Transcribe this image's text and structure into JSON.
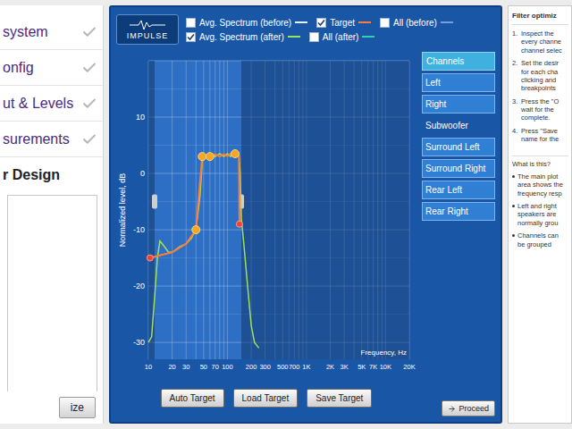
{
  "sidebar": {
    "items": [
      {
        "label": "system",
        "checked": true,
        "selected": false
      },
      {
        "label": "onfig",
        "checked": true,
        "selected": false
      },
      {
        "label": "ut & Levels",
        "checked": true,
        "selected": false
      },
      {
        "label": "surements",
        "checked": true,
        "selected": false
      },
      {
        "label": "r Design",
        "checked": false,
        "selected": true
      }
    ],
    "bottom_button": "ize"
  },
  "logo": "IMPULSE",
  "legend": [
    [
      {
        "label": "Avg. Spectrum (before)",
        "checked": false,
        "color": "#e8eef6"
      },
      {
        "label": "Target",
        "checked": true,
        "color": "#ff7b3a"
      },
      {
        "label": "All (before)",
        "checked": false,
        "color": "#6fa0e0"
      }
    ],
    [
      {
        "label": "Avg. Spectrum (after)",
        "checked": true,
        "color": "#9fe05a"
      },
      {
        "label": "All (after)",
        "checked": false,
        "color": "#2fd3a8"
      }
    ]
  ],
  "chart": {
    "y_axis_title": "Normalized level, dB",
    "x_axis_title": "Frequency, Hz",
    "y_range_db": [
      -33,
      20
    ],
    "x_range_hz": [
      10,
      20000
    ],
    "passband_hz": [
      12,
      150
    ],
    "y_ticks": [
      "10",
      "0",
      "-10",
      "-20",
      "-30"
    ],
    "x_ticks": [
      {
        "label": "10",
        "hz": 10
      },
      {
        "label": "20",
        "hz": 20
      },
      {
        "label": "30",
        "hz": 30
      },
      {
        "label": "50",
        "hz": 50
      },
      {
        "label": "70",
        "hz": 70
      },
      {
        "label": "100",
        "hz": 100
      },
      {
        "label": "200",
        "hz": 200
      },
      {
        "label": "300",
        "hz": 300
      },
      {
        "label": "500",
        "hz": 500
      },
      {
        "label": "700",
        "hz": 700
      },
      {
        "label": "1K",
        "hz": 1000
      },
      {
        "label": "2K",
        "hz": 2000
      },
      {
        "label": "3K",
        "hz": 3000
      },
      {
        "label": "5K",
        "hz": 5000
      },
      {
        "label": "7K",
        "hz": 7000
      },
      {
        "label": "10K",
        "hz": 10000
      },
      {
        "label": "20K",
        "hz": 20000
      }
    ],
    "series": [
      {
        "name": "Avg. Spectrum (after)",
        "color": "#9fe05a",
        "frequencies": [
          10,
          11,
          12,
          13,
          14,
          16,
          18,
          20,
          25,
          30,
          35,
          40,
          45,
          48,
          50,
          60,
          70,
          80,
          90,
          100,
          110,
          120,
          130,
          140,
          145,
          150,
          160,
          180,
          200,
          220,
          250
        ],
        "values": [
          -30,
          -29,
          -22,
          -15,
          -12,
          -13,
          -14,
          -14,
          -13,
          -12.5,
          -11.5,
          -10,
          -4,
          2,
          3,
          3.5,
          3,
          3.5,
          3,
          3.5,
          3,
          3.5,
          3.5,
          3,
          0,
          -8,
          -12,
          -20,
          -27,
          -30,
          -31
        ]
      },
      {
        "name": "Target",
        "color": "#ff7b3a",
        "frequencies": [
          10.5,
          20,
          30,
          40,
          48,
          52,
          60,
          70,
          80,
          90,
          100,
          110,
          125,
          140,
          142
        ],
        "values": [
          -15,
          -14,
          -12.5,
          -10,
          3,
          2.8,
          3,
          3.4,
          3,
          3.4,
          3.1,
          3.5,
          3.5,
          3.2,
          -9
        ]
      }
    ],
    "breakpoints": [
      {
        "hz": 10.5,
        "db": -15,
        "kind": "edge"
      },
      {
        "hz": 40,
        "db": -10,
        "kind": "breakpoint"
      },
      {
        "hz": 48,
        "db": 3,
        "kind": "breakpoint"
      },
      {
        "hz": 60,
        "db": 3,
        "kind": "breakpoint"
      },
      {
        "hz": 125,
        "db": 3.5,
        "kind": "breakpoint"
      },
      {
        "hz": 142,
        "db": -9,
        "kind": "edge"
      }
    ]
  },
  "buttons": [
    "Auto Target",
    "Load Target",
    "Save Target"
  ],
  "channels": {
    "title": "Channels",
    "items": [
      {
        "label": "Left",
        "selected": false
      },
      {
        "label": "Right",
        "selected": false
      },
      {
        "label": "Subwoofer",
        "selected": true
      },
      {
        "label": "Surround Left",
        "selected": false
      },
      {
        "label": "Surround Right",
        "selected": false
      },
      {
        "label": "Rear Left",
        "selected": false
      },
      {
        "label": "Rear Right",
        "selected": false
      }
    ]
  },
  "proceed": "Proceed",
  "help": {
    "title": "Filter optimiz",
    "steps": [
      {
        "number": "1.",
        "lines": [
          "Inspect the",
          "every channe",
          "channel selec"
        ]
      },
      {
        "number": "2.",
        "lines": [
          "Set the desir",
          "for each cha",
          "clicking and",
          "breakpoints"
        ]
      },
      {
        "number": "3.",
        "lines": [
          "Press the \"O",
          "wait for the",
          "complete."
        ]
      },
      {
        "number": "4.",
        "lines": [
          "Press \"Save",
          "name for the"
        ]
      }
    ],
    "question": "What is this?",
    "notes": [
      [
        "The main plot",
        "area shows the",
        "frequency resp"
      ],
      [
        "Left and right",
        "speakers are",
        "normally grou"
      ],
      [
        "Channels can",
        "be grouped"
      ]
    ]
  }
}
